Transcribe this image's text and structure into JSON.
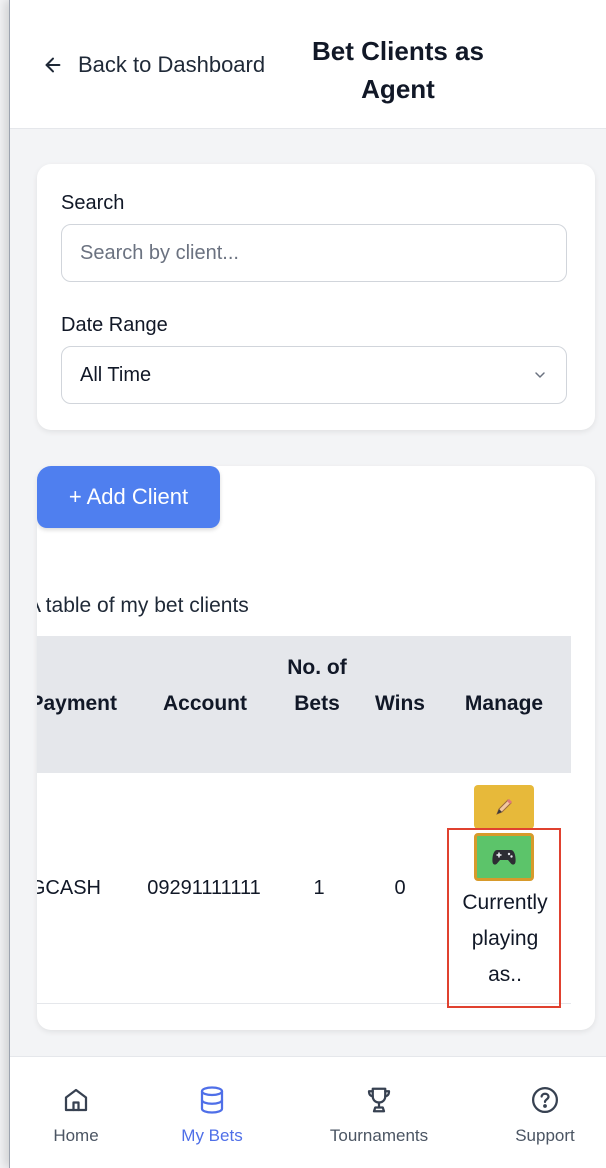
{
  "header": {
    "back_label": "Back to Dashboard",
    "title": "Bet Clients as Agent"
  },
  "filters": {
    "search_label": "Search",
    "search_placeholder": "Search by client...",
    "search_value": "",
    "date_label": "Date Range",
    "date_value": "All Time"
  },
  "clients": {
    "add_button": "+ Add Client",
    "caption": "A table of my bet clients",
    "columns": [
      "Payment",
      "Account",
      "No. of Bets",
      "Wins",
      "Manage"
    ],
    "rows": [
      {
        "payment": "GCASH",
        "account": "09291111111",
        "bets": "1",
        "wins": "0",
        "status": "Currently playing as.."
      }
    ]
  },
  "nav": {
    "items": [
      {
        "label": "Home",
        "icon": "home-icon"
      },
      {
        "label": "My Bets",
        "icon": "database-icon"
      },
      {
        "label": "Tournaments",
        "icon": "trophy-icon"
      },
      {
        "label": "Support",
        "icon": "help-circle-icon"
      }
    ],
    "active": "My Bets"
  },
  "colors": {
    "accent": "#4f7fef",
    "edit_button": "#e7b93a",
    "play_button": "#5cc46a",
    "highlight": "#e0412f"
  }
}
